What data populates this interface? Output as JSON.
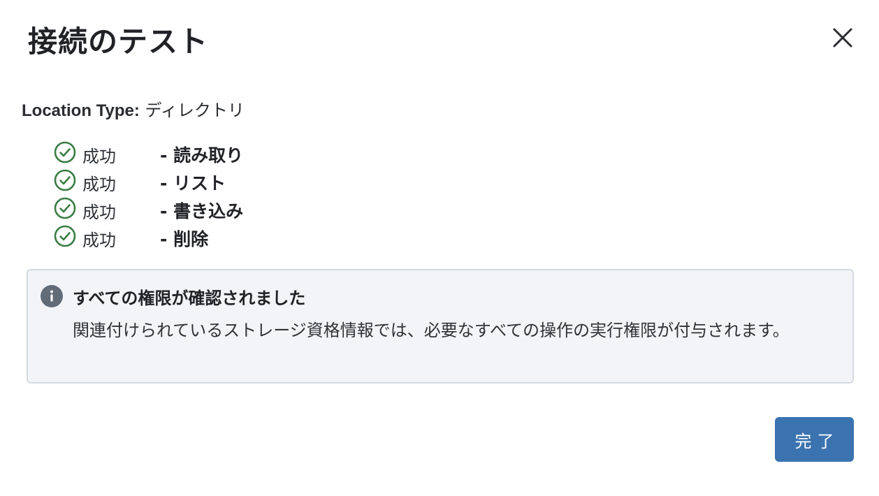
{
  "dialog": {
    "title": "接続のテスト",
    "close_icon": "close-icon"
  },
  "location": {
    "label": "Location Type:",
    "value": "ディレクトリ"
  },
  "checks": [
    {
      "status": "成功",
      "operation": "- 読み取り",
      "icon": "check-circle-icon"
    },
    {
      "status": "成功",
      "operation": "- リスト",
      "icon": "check-circle-icon"
    },
    {
      "status": "成功",
      "operation": "- 書き込み",
      "icon": "check-circle-icon"
    },
    {
      "status": "成功",
      "operation": "- 削除",
      "icon": "check-circle-icon"
    }
  ],
  "info": {
    "icon": "info-icon",
    "title": "すべての権限が確認されました",
    "body": "関連付けられているストレージ資格情報では、必要なすべての操作の実行権限が付与されます。"
  },
  "footer": {
    "done_label": "完了"
  },
  "colors": {
    "success": "#3a7d44",
    "primary": "#3a73b0",
    "info_bg": "#f2f4f7",
    "info_border": "#d5dae1",
    "info_icon": "#626b78"
  }
}
